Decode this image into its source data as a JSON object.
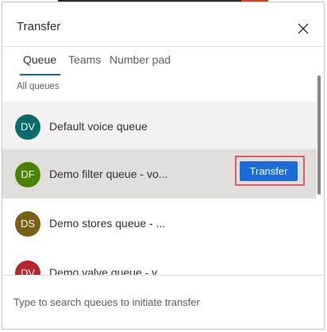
{
  "dialog": {
    "title": "Transfer",
    "close_icon": "close-icon"
  },
  "tabs": [
    {
      "label": "Queue",
      "active": true
    },
    {
      "label": "Teams",
      "active": false
    },
    {
      "label": "Number pad",
      "active": false
    }
  ],
  "section_label": "All queues",
  "queues": [
    {
      "initials": "DV",
      "name": "Default voice queue",
      "avatar_color": "#0b6a6b"
    },
    {
      "initials": "DF",
      "name": "Demo filter queue - vo...",
      "avatar_color": "#498205"
    },
    {
      "initials": "DS",
      "name": "Demo stores queue - ...",
      "avatar_color": "#795e18"
    },
    {
      "initials": "DV",
      "name": "Demo valve queue - v...",
      "avatar_color": "#b4262a"
    }
  ],
  "transfer_button_label": "Transfer",
  "search": {
    "placeholder": "Type to search queues to initiate transfer",
    "value": ""
  },
  "colors": {
    "accent": "#1b6cd8",
    "tab_underline": "#0f6cbd",
    "highlight_outline": "#e25a62"
  }
}
